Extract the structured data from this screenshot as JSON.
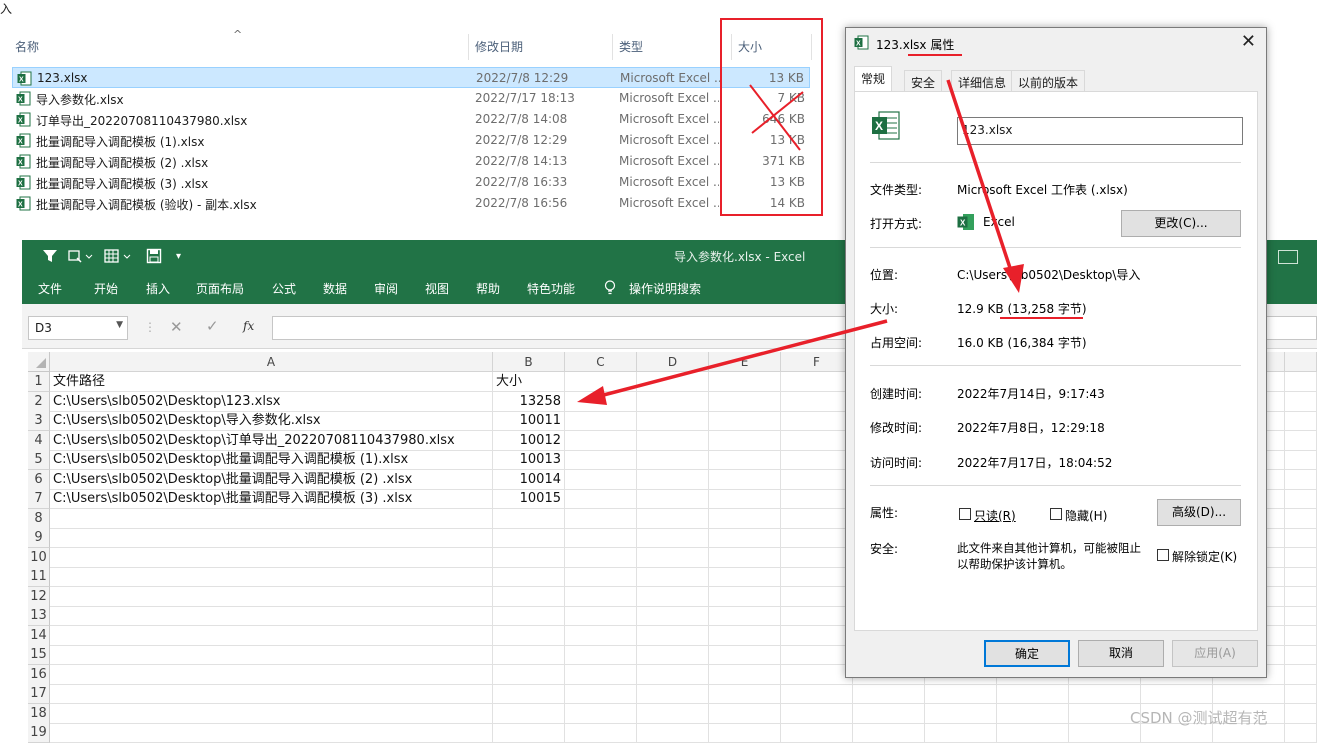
{
  "explorer": {
    "top_text": "入",
    "headers": {
      "name": "名称",
      "date": "修改日期",
      "type": "类型",
      "size": "大小"
    },
    "files": [
      {
        "name": "123.xlsx",
        "date": "2022/7/8 12:29",
        "type": "Microsoft Excel ...",
        "size": "13 KB",
        "selected": true
      },
      {
        "name": "导入参数化.xlsx",
        "date": "2022/7/17 18:13",
        "type": "Microsoft Excel ...",
        "size": "7 KB"
      },
      {
        "name": "订单导出_20220708110437980.xlsx",
        "date": "2022/7/8 14:08",
        "type": "Microsoft Excel ...",
        "size": "646 KB"
      },
      {
        "name": "批量调配导入调配模板 (1).xlsx",
        "date": "2022/7/8 12:29",
        "type": "Microsoft Excel ...",
        "size": "13 KB"
      },
      {
        "name": "批量调配导入调配模板 (2) .xlsx",
        "date": "2022/7/8 14:13",
        "type": "Microsoft Excel ...",
        "size": "371 KB"
      },
      {
        "name": "批量调配导入调配模板 (3) .xlsx",
        "date": "2022/7/8 16:33",
        "type": "Microsoft Excel ...",
        "size": "13 KB"
      },
      {
        "name": "批量调配导入调配模板 (验收) - 副本.xlsx",
        "date": "2022/7/8 16:56",
        "type": "Microsoft Excel ...",
        "size": "14 KB"
      }
    ]
  },
  "excel": {
    "title": "导入参数化.xlsx  -  Excel",
    "tabs": [
      "文件",
      "开始",
      "插入",
      "页面布局",
      "公式",
      "数据",
      "审阅",
      "视图",
      "帮助",
      "特色功能",
      "操作说明搜索"
    ],
    "name_box": "D3",
    "fx_label": "fx",
    "columns": [
      "A",
      "B",
      "C",
      "D",
      "E",
      "F"
    ],
    "rows": [
      {
        "n": "1",
        "a": "文件路径",
        "b": "大小"
      },
      {
        "n": "2",
        "a": "C:\\Users\\slb0502\\Desktop\\123.xlsx",
        "b": "13258"
      },
      {
        "n": "3",
        "a": "C:\\Users\\slb0502\\Desktop\\导入参数化.xlsx",
        "b": "10011"
      },
      {
        "n": "4",
        "a": "C:\\Users\\slb0502\\Desktop\\订单导出_20220708110437980.xlsx",
        "b": "10012"
      },
      {
        "n": "5",
        "a": "C:\\Users\\slb0502\\Desktop\\批量调配导入调配模板 (1).xlsx",
        "b": "10013"
      },
      {
        "n": "6",
        "a": "C:\\Users\\slb0502\\Desktop\\批量调配导入调配模板 (2) .xlsx",
        "b": "10014"
      },
      {
        "n": "7",
        "a": "C:\\Users\\slb0502\\Desktop\\批量调配导入调配模板 (3) .xlsx",
        "b": "10015"
      },
      {
        "n": "8",
        "a": "",
        "b": ""
      },
      {
        "n": "9",
        "a": "",
        "b": ""
      },
      {
        "n": "10",
        "a": "",
        "b": ""
      },
      {
        "n": "11",
        "a": "",
        "b": ""
      },
      {
        "n": "12",
        "a": "",
        "b": ""
      },
      {
        "n": "13",
        "a": "",
        "b": ""
      },
      {
        "n": "14",
        "a": "",
        "b": ""
      },
      {
        "n": "15",
        "a": "",
        "b": ""
      },
      {
        "n": "16",
        "a": "",
        "b": ""
      },
      {
        "n": "17",
        "a": "",
        "b": ""
      },
      {
        "n": "18",
        "a": "",
        "b": ""
      },
      {
        "n": "19",
        "a": "",
        "b": ""
      }
    ]
  },
  "dialog": {
    "title": "123.xlsx 属性",
    "tabs": [
      "常规",
      "安全",
      "详细信息",
      "以前的版本"
    ],
    "filename": "123.xlsx",
    "file_type_label": "文件类型:",
    "file_type": "Microsoft Excel 工作表 (.xlsx)",
    "open_with_label": "打开方式:",
    "open_with": "Excel",
    "change_button": "更改(C)...",
    "location_label": "位置:",
    "location": "C:\\Users\\slb0502\\Desktop\\导入",
    "size_label": "大小:",
    "size": "12.9 KB (13,258 字节)",
    "disk_label": "占用空间:",
    "disk": "16.0 KB (16,384 字节)",
    "created_label": "创建时间:",
    "created": "2022年7月14日，9:17:43",
    "modified_label": "修改时间:",
    "modified": "2022年7月8日，12:29:18",
    "accessed_label": "访问时间:",
    "accessed": "2022年7月17日，18:04:52",
    "attr_label": "属性:",
    "readonly": "只读(R)",
    "hidden": "隐藏(H)",
    "advanced_button": "高级(D)...",
    "security_label": "安全:",
    "security_text1": "此文件来自其他计算机，可能被阻止",
    "security_text2": "以帮助保护该计算机。",
    "unblock": "解除锁定(K)",
    "ok": "确定",
    "cancel": "取消",
    "apply": "应用(A)"
  },
  "watermark": "CSDN @测试超有范",
  "colors": {
    "excel_green": "#217346",
    "annotation_red": "#e8202a",
    "selection": "#cce8ff"
  }
}
